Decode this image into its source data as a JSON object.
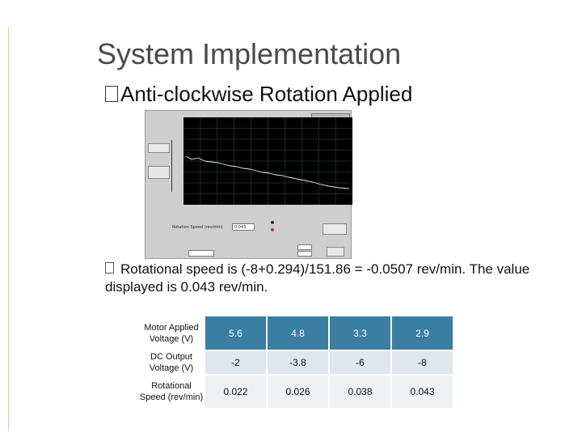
{
  "slide": {
    "title": "System Implementation",
    "subtitle": "Anti-clockwise Rotation Applied",
    "bullet": "Rotational speed is (-8+0.294)/151.86 = -0.0507 rev/min. The value displayed is 0.043 rev/min."
  },
  "screenshot": {
    "speed_label": "Rotation Speed (rev/min)",
    "speed_value": "0.043"
  },
  "table": {
    "row_headers": [
      "Motor Applied Voltage (V)",
      "DC Output Voltage (V)",
      "Rotational Speed (rev/min)"
    ],
    "rows": [
      [
        "5.6",
        "4.8",
        "3.3",
        "2.9"
      ],
      [
        "-2",
        "-3.8",
        "-6",
        "-8"
      ],
      [
        "0.022",
        "0.026",
        "0.038",
        "0.043"
      ]
    ]
  },
  "colors": {
    "header_row": "#3a7ea1",
    "row_alt_1": "#dfe6ec",
    "row_alt_2": "#eef2f5"
  }
}
